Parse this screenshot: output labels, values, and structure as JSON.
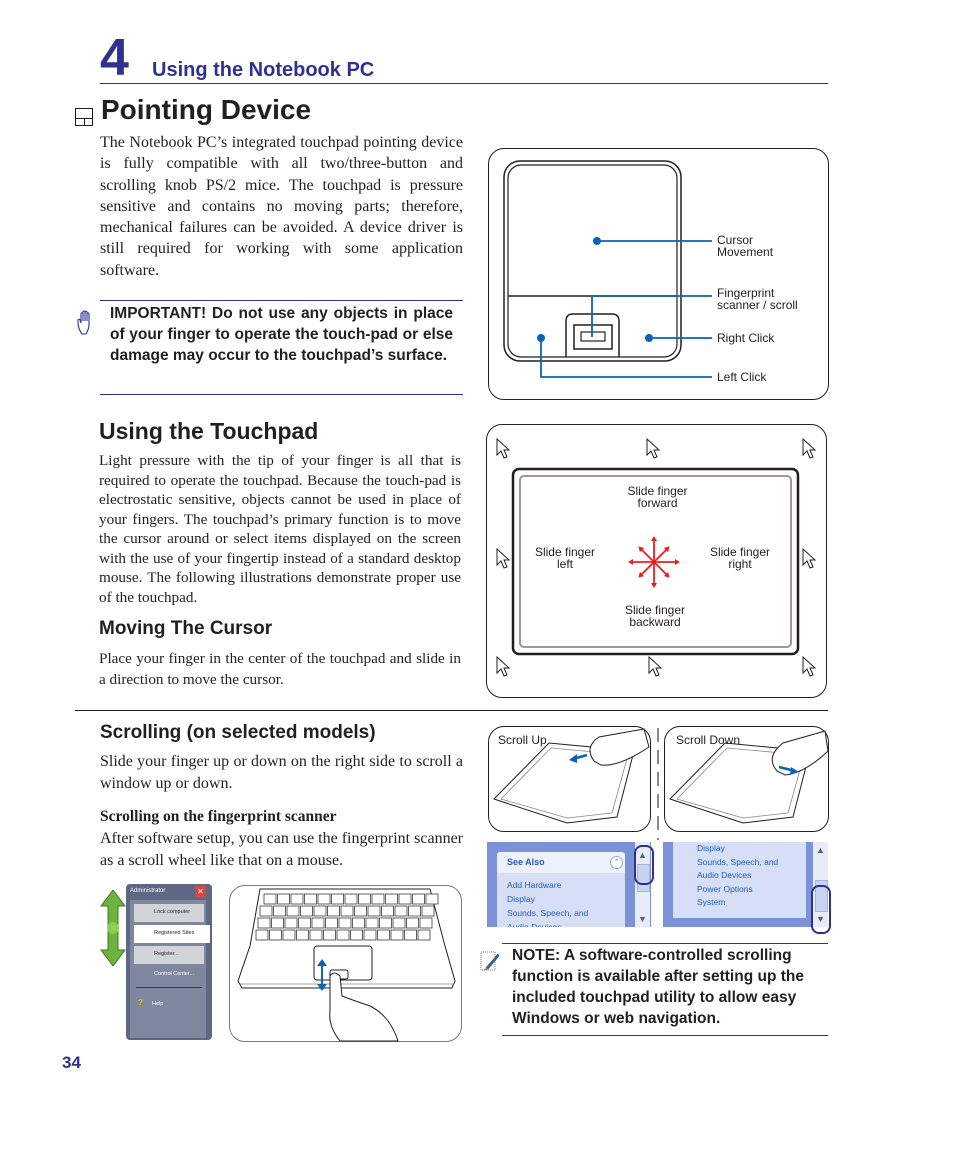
{
  "header": {
    "chapter_number": "4",
    "chapter_title": "Using the Notebook PC"
  },
  "section": {
    "title": "Pointing Device",
    "intro": "The Notebook PC’s integrated touchpad pointing device is fully compatible with all two/three-button and scrolling knob PS/2 mice. The touchpad is pressure sensitive and contains no moving parts; therefore, mechanical failures can be avoided. A device driver is still required for working with some application software."
  },
  "important": {
    "icon": "hand-stop-icon",
    "text": "IMPORTANT! Do not use any objects in place of your finger to operate the touch-pad or else damage may occur to the touchpad’s surface."
  },
  "touchpad_diagram": {
    "labels": {
      "cursor_movement_1": "Cursor",
      "cursor_movement_2": "Movement",
      "fingerprint_1": "Fingerprint",
      "fingerprint_2": "scanner / scroll",
      "right_click": "Right Click",
      "left_click": "Left Click"
    },
    "accent_color": "#0a63b4"
  },
  "using_touchpad": {
    "title": "Using the Touchpad",
    "text": "Light pressure with the tip of your finger is all that is required to operate the touchpad. Because the touch-pad is electrostatic sensitive, objects cannot be used in place of your fingers. The touchpad’s primary function is to move the cursor around or select items displayed on the screen with the use of your fingertip instead of a standard desktop mouse. The following illustrations demonstrate proper use of the touchpad."
  },
  "moving_cursor": {
    "title": "Moving The Cursor",
    "text": "Place your finger in the center of the touchpad and slide in a direction to move the cursor."
  },
  "direction_diagram": {
    "forward_1": "Slide finger",
    "forward_2": "forward",
    "left_1": "Slide finger",
    "left_2": "left",
    "right_1": "Slide finger",
    "right_2": "right",
    "backward_1": "Slide finger",
    "backward_2": "backward",
    "arrow_color": "#ed1c24"
  },
  "scrolling": {
    "title": "Scrolling (on selected models)",
    "text": "Slide your finger up or down on the right side to scroll a window up or down.",
    "fp_title": "Scrolling on the fingerprint scanner",
    "fp_text": "After software setup, you can use the fingerprint scanner as a scroll wheel like that on a mouse.",
    "scroll_up_label": "Scroll Up",
    "scroll_down_label": "Scroll Down"
  },
  "windows_panel_left": {
    "header": "See Also",
    "items": [
      "Add Hardware",
      "Display",
      "Sounds, Speech, and",
      "Audio Devices"
    ]
  },
  "windows_panel_right": {
    "items": [
      "Display",
      "Sounds, Speech, and",
      "Audio Devices",
      "Power Options",
      "System"
    ]
  },
  "fp_menu": {
    "title": "Administrator",
    "items": [
      "Lock computer",
      "Registered Sites",
      "Register...",
      "Control Center...",
      "Help"
    ]
  },
  "note": {
    "icon": "note-pencil-icon",
    "text": "NOTE: A software-controlled scrolling function is available after setting up the included touchpad utility to allow easy Windows or web navigation."
  },
  "footer": {
    "page_number": "34"
  }
}
